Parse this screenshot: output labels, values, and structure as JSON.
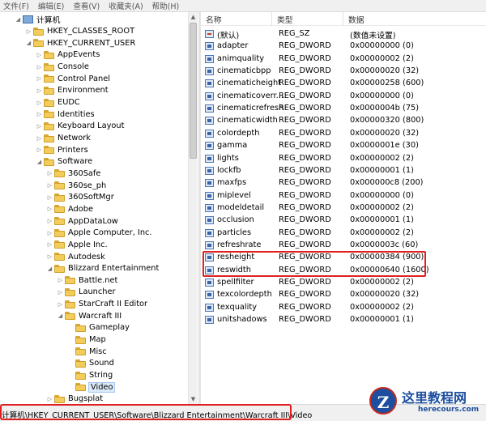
{
  "menu": [
    "文件(F)",
    "编辑(E)",
    "查看(V)",
    "收藏夹(A)",
    "帮助(H)"
  ],
  "tree": [
    {
      "label": "计算机",
      "level": 0,
      "expanded": true,
      "icon": "computer-icon"
    },
    {
      "label": "HKEY_CLASSES_ROOT",
      "level": 1,
      "expanded": false
    },
    {
      "label": "HKEY_CURRENT_USER",
      "level": 1,
      "expanded": true
    },
    {
      "label": "AppEvents",
      "level": 2,
      "expanded": false
    },
    {
      "label": "Console",
      "level": 2,
      "expanded": false
    },
    {
      "label": "Control Panel",
      "level": 2,
      "expanded": false
    },
    {
      "label": "Environment",
      "level": 2,
      "expanded": false
    },
    {
      "label": "EUDC",
      "level": 2,
      "expanded": false
    },
    {
      "label": "Identities",
      "level": 2,
      "expanded": false
    },
    {
      "label": "Keyboard Layout",
      "level": 2,
      "expanded": false
    },
    {
      "label": "Network",
      "level": 2,
      "expanded": false
    },
    {
      "label": "Printers",
      "level": 2,
      "expanded": false
    },
    {
      "label": "Software",
      "level": 2,
      "expanded": true
    },
    {
      "label": "360Safe",
      "level": 3,
      "expanded": false
    },
    {
      "label": "360se_ph",
      "level": 3,
      "expanded": false
    },
    {
      "label": "360SoftMgr",
      "level": 3,
      "expanded": false
    },
    {
      "label": "Adobe",
      "level": 3,
      "expanded": false
    },
    {
      "label": "AppDataLow",
      "level": 3,
      "expanded": false
    },
    {
      "label": "Apple Computer, Inc.",
      "level": 3,
      "expanded": false
    },
    {
      "label": "Apple Inc.",
      "level": 3,
      "expanded": false
    },
    {
      "label": "Autodesk",
      "level": 3,
      "expanded": false
    },
    {
      "label": "Blizzard Entertainment",
      "level": 3,
      "expanded": true
    },
    {
      "label": "Battle.net",
      "level": 4,
      "expanded": false
    },
    {
      "label": "Launcher",
      "level": 4,
      "expanded": false
    },
    {
      "label": "StarCraft II Editor",
      "level": 4,
      "expanded": false
    },
    {
      "label": "Warcraft III",
      "level": 4,
      "expanded": true
    },
    {
      "label": "Gameplay",
      "level": 5,
      "leaf": true
    },
    {
      "label": "Map",
      "level": 5,
      "leaf": true
    },
    {
      "label": "Misc",
      "level": 5,
      "leaf": true
    },
    {
      "label": "Sound",
      "level": 5,
      "leaf": true
    },
    {
      "label": "String",
      "level": 5,
      "leaf": true
    },
    {
      "label": "Video",
      "level": 5,
      "leaf": true,
      "selected": true
    },
    {
      "label": "Bugsplat",
      "level": 3,
      "expanded": false
    }
  ],
  "columns": {
    "name": "名称",
    "type": "类型",
    "data": "数据"
  },
  "values": [
    {
      "name": "(默认)",
      "type": "REG_SZ",
      "data": "(数值未设置)",
      "kind": "sz"
    },
    {
      "name": "adapter",
      "type": "REG_DWORD",
      "data": "0x00000000 (0)"
    },
    {
      "name": "animquality",
      "type": "REG_DWORD",
      "data": "0x00000002 (2)"
    },
    {
      "name": "cinematicbpp",
      "type": "REG_DWORD",
      "data": "0x00000020 (32)"
    },
    {
      "name": "cinematicheight",
      "type": "REG_DWORD",
      "data": "0x00000258 (600)"
    },
    {
      "name": "cinematicoverr...",
      "type": "REG_DWORD",
      "data": "0x00000000 (0)"
    },
    {
      "name": "cinematicrefresh",
      "type": "REG_DWORD",
      "data": "0x0000004b (75)"
    },
    {
      "name": "cinematicwidth",
      "type": "REG_DWORD",
      "data": "0x00000320 (800)"
    },
    {
      "name": "colordepth",
      "type": "REG_DWORD",
      "data": "0x00000020 (32)"
    },
    {
      "name": "gamma",
      "type": "REG_DWORD",
      "data": "0x0000001e (30)"
    },
    {
      "name": "lights",
      "type": "REG_DWORD",
      "data": "0x00000002 (2)"
    },
    {
      "name": "lockfb",
      "type": "REG_DWORD",
      "data": "0x00000001 (1)"
    },
    {
      "name": "maxfps",
      "type": "REG_DWORD",
      "data": "0x000000c8 (200)"
    },
    {
      "name": "miplevel",
      "type": "REG_DWORD",
      "data": "0x00000000 (0)"
    },
    {
      "name": "modeldetail",
      "type": "REG_DWORD",
      "data": "0x00000002 (2)"
    },
    {
      "name": "occlusion",
      "type": "REG_DWORD",
      "data": "0x00000001 (1)"
    },
    {
      "name": "particles",
      "type": "REG_DWORD",
      "data": "0x00000002 (2)"
    },
    {
      "name": "refreshrate",
      "type": "REG_DWORD",
      "data": "0x0000003c (60)"
    },
    {
      "name": "resheight",
      "type": "REG_DWORD",
      "data": "0x00000384 (900)"
    },
    {
      "name": "reswidth",
      "type": "REG_DWORD",
      "data": "0x00000640 (1600)"
    },
    {
      "name": "spellfilter",
      "type": "REG_DWORD",
      "data": "0x00000002 (2)"
    },
    {
      "name": "texcolordepth",
      "type": "REG_DWORD",
      "data": "0x00000020 (32)"
    },
    {
      "name": "texquality",
      "type": "REG_DWORD",
      "data": "0x00000002 (2)"
    },
    {
      "name": "unitshadows",
      "type": "REG_DWORD",
      "data": "0x00000001 (1)"
    }
  ],
  "status": {
    "path": "计算机\\HKEY_CURRENT_USER\\Software\\Blizzard Entertainment\\Warcraft III\\Video"
  },
  "watermark": {
    "title": "这里教程网",
    "url": "herecours.com",
    "logo_letter": "Z"
  },
  "colors": {
    "highlight": "#e02020",
    "selection": "#dbe9f8",
    "brand": "#1d4f9e"
  }
}
